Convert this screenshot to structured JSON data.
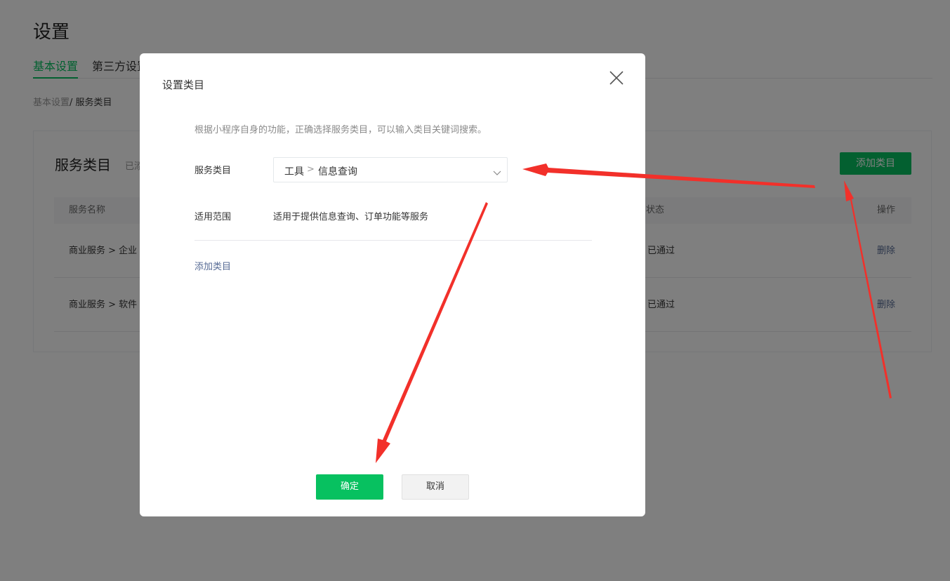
{
  "page": {
    "title": "设置",
    "tabs": [
      {
        "label": "基本设置",
        "active": true
      },
      {
        "label": "第三方设置",
        "active": false
      }
    ],
    "breadcrumb": {
      "parent": "基本设置",
      "sep": "/ ",
      "current": "服务类目"
    },
    "panel": {
      "title": "服务类目",
      "subtitle": "已添",
      "add_button": "添加类目",
      "columns": {
        "name": "服务名称",
        "status": "状态",
        "action": "操作"
      },
      "rows": [
        {
          "name": "商业服务  >  企业",
          "status": "已通过",
          "action": "删除"
        },
        {
          "name": "商业服务  >  软件",
          "status": "已通过",
          "action": "删除"
        }
      ]
    }
  },
  "dialog": {
    "title": "设置类目",
    "tip": "根据小程序自身的功能，正确选择服务类目，可以输入类目关键词搜索。",
    "category_label": "服务类目",
    "category_level1": "工具",
    "category_separator": ">",
    "category_level2": "信息查询",
    "scope_label": "适用范围",
    "scope_value": "适用于提供信息查询、订单功能等服务",
    "add_link": "添加类目",
    "confirm": "确定",
    "cancel": "取消"
  },
  "colors": {
    "accent": "#07c160",
    "link": "#576b95",
    "annotation": "#f2302a",
    "mask": "rgba(0,0,0,0.5)"
  },
  "icons": [
    "close-icon",
    "chevron-down-icon",
    "annotation-arrow"
  ]
}
